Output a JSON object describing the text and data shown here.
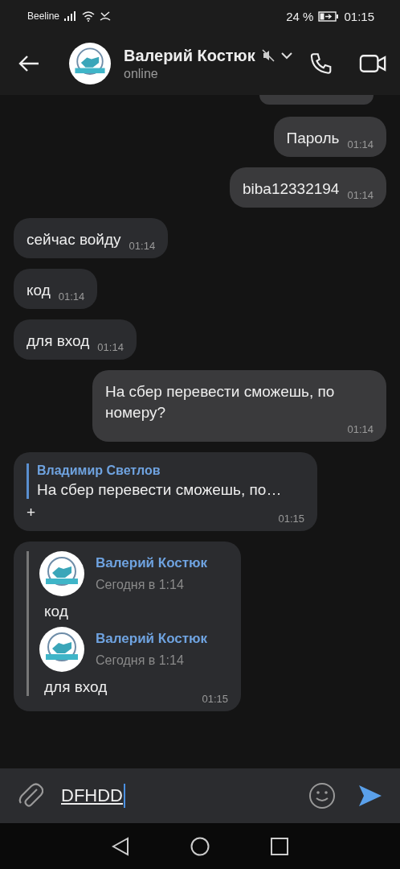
{
  "status_bar": {
    "carrier": "Beeline",
    "battery": "24 %",
    "time": "01:15"
  },
  "header": {
    "name": "Валерий Костюк",
    "subtitle": "online",
    "muted": true
  },
  "messages": [
    {
      "kind": "cut",
      "outgoing": true
    },
    {
      "kind": "text",
      "outgoing": true,
      "text": "Пароль",
      "time": "01:14"
    },
    {
      "kind": "text",
      "outgoing": true,
      "text": "biba12332194",
      "time": "01:14"
    },
    {
      "kind": "text",
      "outgoing": false,
      "text": "сейчас войду",
      "time": "01:14"
    },
    {
      "kind": "text",
      "outgoing": false,
      "text": "код",
      "time": "01:14"
    },
    {
      "kind": "text",
      "outgoing": false,
      "text": "для вход",
      "time": "01:14"
    },
    {
      "kind": "text",
      "outgoing": true,
      "text": "На сбер перевести сможешь, по номеру?",
      "time": "01:14"
    },
    {
      "kind": "reply",
      "quote_author": "Владимир Светлов",
      "quote_text": "На сбер перевести сможешь, по…",
      "text": "+",
      "time": "01:15"
    },
    {
      "kind": "forward",
      "items": [
        {
          "author": "Валерий Костюк",
          "date": "Сегодня в 1:14",
          "text": "код"
        },
        {
          "author": "Валерий Костюк",
          "date": "Сегодня в 1:14",
          "text": "для вход"
        }
      ],
      "time": "01:15"
    }
  ],
  "composer": {
    "value": "DFHDD"
  }
}
